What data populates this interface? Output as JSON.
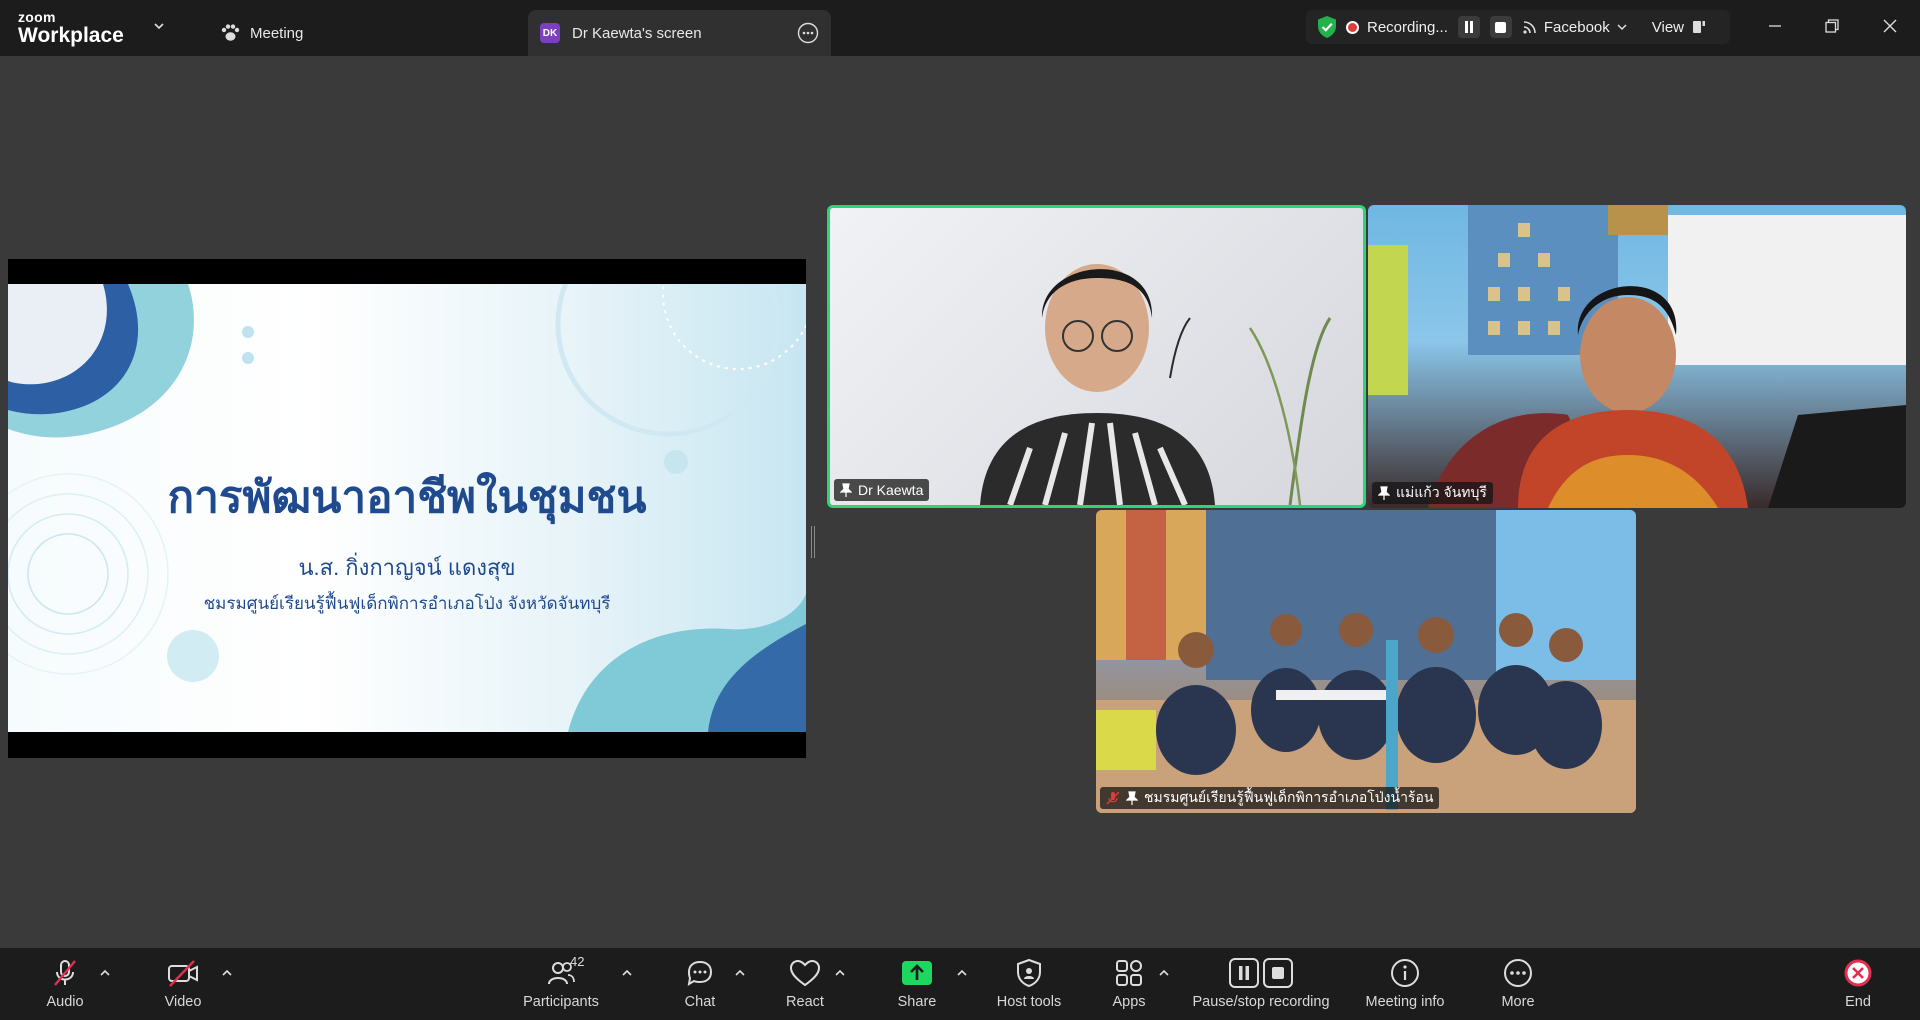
{
  "titlebar": {
    "logo_top": "zoom",
    "logo_bottom": "Workplace",
    "meeting_tab": "Meeting",
    "screen_tab": {
      "badge": "DK",
      "label": "Dr Kaewta's screen"
    },
    "recording": {
      "status": "Recording...",
      "stream_target": "Facebook",
      "view_label": "View"
    }
  },
  "slide": {
    "title": "การพัฒนาอาชีพในชุมชน",
    "presenter": "น.ส. กิ่งกาญจน์  แดงสุข",
    "organization": "ชมรมศูนย์เรียนรู้ฟื้นฟูเด็กพิการอำเภอโป่ง จังหวัดจันทบุรี"
  },
  "participants": [
    {
      "name": "Dr Kaewta",
      "active_speaker": true,
      "muted": false
    },
    {
      "name": "แม่แก้ว  จันทบุรี",
      "active_speaker": false,
      "muted": false
    },
    {
      "name": "ชมรมศูนย์เรียนรู้ฟื้นฟูเด็กพิการอำเภอโป่งน้ำร้อน",
      "active_speaker": false,
      "muted": true
    }
  ],
  "toolbar": {
    "audio": "Audio",
    "video": "Video",
    "participants": "Participants",
    "participants_count": "42",
    "chat": "Chat",
    "react": "React",
    "share": "Share",
    "host_tools": "Host tools",
    "apps": "Apps",
    "pause_stop": "Pause/stop recording",
    "meeting_info": "Meeting info",
    "more": "More",
    "end": "End"
  },
  "colors": {
    "active_speaker_border": "#2ed577",
    "share_green": "#1ed760",
    "recording_red": "#e03b3b",
    "end_red": "#e02f4f",
    "slide_title": "#1f4a8e"
  }
}
